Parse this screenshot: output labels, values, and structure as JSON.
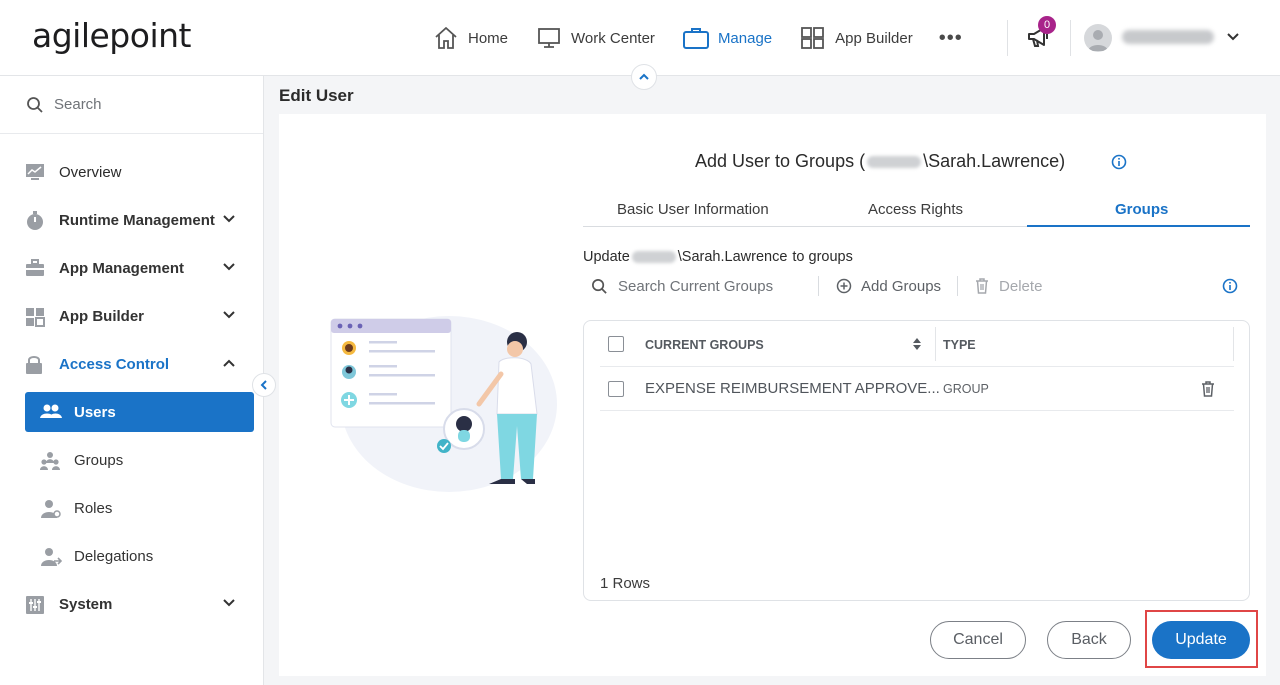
{
  "header": {
    "logo_text": "agilepoint",
    "nav": [
      {
        "label": "Home",
        "icon": "home-icon"
      },
      {
        "label": "Work Center",
        "icon": "monitor-icon"
      },
      {
        "label": "Manage",
        "icon": "briefcase-icon",
        "active": true
      },
      {
        "label": "App Builder",
        "icon": "grid-icon"
      }
    ],
    "more": "•••",
    "notification_count": "0"
  },
  "sidebar": {
    "search_placeholder": "Search",
    "items": [
      {
        "label": "Overview",
        "icon": "chart-icon"
      },
      {
        "label": "Runtime Management",
        "icon": "stopwatch-icon"
      },
      {
        "label": "App Management",
        "icon": "toolbox-icon"
      },
      {
        "label": "App Builder",
        "icon": "grid-icon"
      },
      {
        "label": "Access Control",
        "icon": "lock-icon"
      }
    ],
    "sub_items": [
      {
        "label": "Users",
        "icon": "users-icon"
      },
      {
        "label": "Groups",
        "icon": "groups-icon"
      },
      {
        "label": "Roles",
        "icon": "user-key-icon"
      },
      {
        "label": "Delegations",
        "icon": "delegate-icon"
      }
    ],
    "bottom_item": {
      "label": "System",
      "icon": "sliders-icon"
    }
  },
  "page": {
    "title": "Edit User"
  },
  "dialog": {
    "title_prefix": "Add User to Groups (",
    "title_user": "\\Sarah.Lawrence)",
    "tabs": [
      "Basic User Information",
      "Access Rights",
      "Groups"
    ],
    "active_tab": "Groups",
    "update_prefix": "Update",
    "update_user": "\\Sarah.Lawrence",
    "update_suffix": "to groups",
    "toolbar": {
      "search_placeholder": "Search Current Groups",
      "add_label": "Add Groups",
      "delete_label": "Delete"
    },
    "table": {
      "columns": [
        "CURRENT GROUPS",
        "TYPE"
      ],
      "rows": [
        {
          "group": "EXPENSE REIMBURSEMENT APPROVE...",
          "type": "GROUP"
        }
      ],
      "rows_count": "1 Rows"
    },
    "buttons": {
      "cancel": "Cancel",
      "back": "Back",
      "update": "Update"
    }
  },
  "colors": {
    "accent": "#1a73c7",
    "badge": "#a8238a",
    "highlight": "#e04646"
  }
}
